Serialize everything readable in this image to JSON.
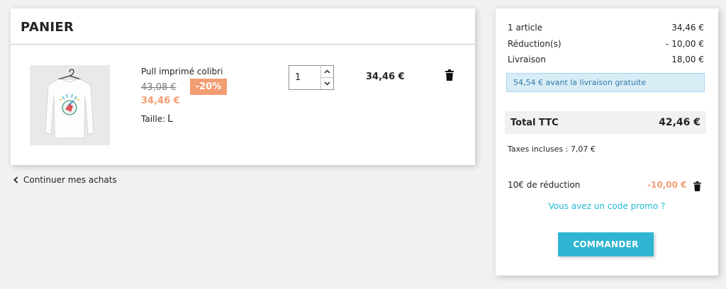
{
  "cart": {
    "title": "PANIER",
    "item": {
      "name": "Pull imprimé colibri",
      "old_price": "43,08 €",
      "discount_badge": "-20%",
      "price": "34,46 €",
      "size_label": "Taille:",
      "size_value": "L",
      "quantity": "1",
      "line_total": "34,46 €",
      "image_icon": "sweater-image"
    },
    "continue_label": "Continuer mes achats"
  },
  "summary": {
    "rows": [
      {
        "label": "1 article",
        "value": "34,46 €"
      },
      {
        "label": "Réduction(s)",
        "value": "- 10,00 €"
      },
      {
        "label": "Livraison",
        "value": "18,00 €"
      }
    ],
    "free_shipping_notice": "54,54 € avant la livraison gratuite",
    "total_label": "Total TTC",
    "total_value": "42,46 €",
    "taxes_line": "Taxes incluses : 7,07 €",
    "voucher_name": "10€ de réduction",
    "voucher_value": "-10,00 €",
    "promo_link": "Vous avez un code promo ?",
    "checkout_label": "COMMANDER"
  },
  "colors": {
    "accent": "#2fb5d2",
    "discount": "#f39d72",
    "info_bg": "#d9edf7",
    "info_text": "#2e7ba8",
    "link": "#25b9d7"
  }
}
